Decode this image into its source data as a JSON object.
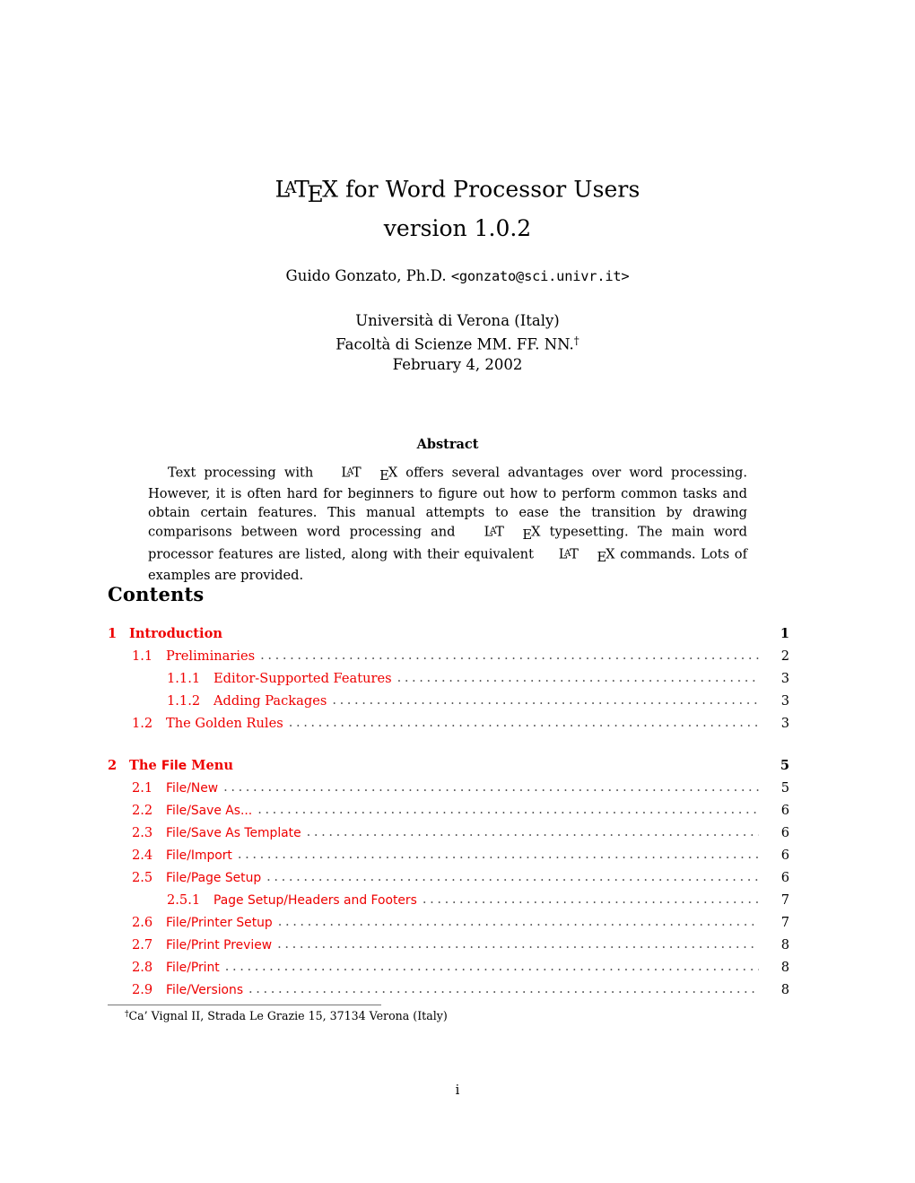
{
  "document": {
    "title_prefix": "L",
    "title_rest": " for Word Processor Users",
    "subtitle": "version 1.0.2",
    "author_name": "Guido Gonzato, Ph.D. ",
    "author_email": "<gonzato@sci.univr.it>",
    "affiliation_1": "Università di Verona (Italy)",
    "affiliation_2": "Facoltà di Scienze MM. FF. NN.",
    "affiliation_dagger": "†",
    "date": "February 4, 2002",
    "page_number": "i"
  },
  "abstract": {
    "heading": "Abstract",
    "part1": "Text processing with ",
    "part2": " offers several advantages over word processing. However, it is often hard for beginners to figure out how to perform common tasks and obtain certain features. This manual attempts to ease the transition by drawing comparisons between word processing and ",
    "part3": " typesetting. The main word processor features are listed, along with their equivalent ",
    "part4": " commands. Lots of examples are provided."
  },
  "contents": {
    "heading": "Contents",
    "entries": [
      {
        "level": "sec",
        "num": "1",
        "label": "Introduction",
        "page": "1",
        "sans": false,
        "spaced": false
      },
      {
        "level": "sub",
        "num": "1.1",
        "label": "Preliminaries",
        "page": "2",
        "sans": false,
        "spaced": false
      },
      {
        "level": "subsub",
        "num": "1.1.1",
        "label": "Editor-Supported Features",
        "page": "3",
        "sans": false,
        "spaced": false
      },
      {
        "level": "subsub",
        "num": "1.1.2",
        "label": "Adding Packages",
        "page": "3",
        "sans": false,
        "spaced": false
      },
      {
        "level": "sub",
        "num": "1.2",
        "label": "The Golden Rules",
        "page": "3",
        "sans": false,
        "spaced": false
      },
      {
        "level": "sec",
        "num": "2",
        "label": "The File Menu",
        "page": "5",
        "sans": false,
        "spaced": true,
        "sans_word": "File"
      },
      {
        "level": "sub",
        "num": "2.1",
        "label": "File/New",
        "page": "5",
        "sans": true,
        "spaced": false
      },
      {
        "level": "sub",
        "num": "2.2",
        "label": "File/Save As...",
        "page": "6",
        "sans": true,
        "spaced": false
      },
      {
        "level": "sub",
        "num": "2.3",
        "label": "File/Save As Template",
        "page": "6",
        "sans": true,
        "spaced": false
      },
      {
        "level": "sub",
        "num": "2.4",
        "label": "File/Import",
        "page": "6",
        "sans": true,
        "spaced": false
      },
      {
        "level": "sub",
        "num": "2.5",
        "label": "File/Page Setup",
        "page": "6",
        "sans": true,
        "spaced": false
      },
      {
        "level": "subsub",
        "num": "2.5.1",
        "label": "Page Setup/Headers and Footers",
        "page": "7",
        "sans": true,
        "spaced": false
      },
      {
        "level": "sub",
        "num": "2.6",
        "label": "File/Printer Setup",
        "page": "7",
        "sans": true,
        "spaced": false
      },
      {
        "level": "sub",
        "num": "2.7",
        "label": "File/Print Preview",
        "page": "8",
        "sans": true,
        "spaced": false
      },
      {
        "level": "sub",
        "num": "2.8",
        "label": "File/Print",
        "page": "8",
        "sans": true,
        "spaced": false
      },
      {
        "level": "sub",
        "num": "2.9",
        "label": "File/Versions",
        "page": "8",
        "sans": true,
        "spaced": false
      }
    ]
  },
  "footnote": {
    "marker": "†",
    "text": "Ca’ Vignal II, Strada Le Grazie 15, 37134 Verona (Italy)"
  },
  "colors": {
    "link_red": "#ee0000",
    "text_black": "#000000",
    "dot_gray": "#555555"
  }
}
